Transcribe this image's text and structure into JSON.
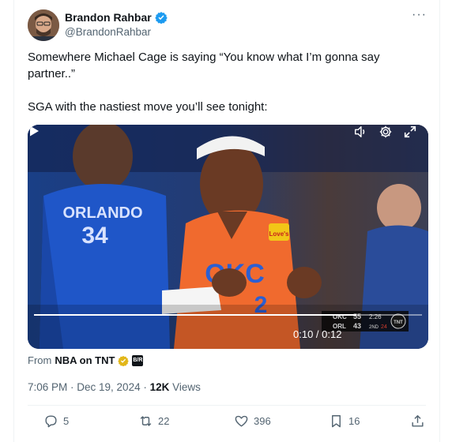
{
  "author": {
    "name": "Brandon Rahbar",
    "handle": "@BrandonRahbar",
    "verified": true
  },
  "more_menu": "···",
  "tweet": {
    "line1": "Somewhere Michael Cage is saying “You know what I’m gonna say partner..”",
    "line2": "SGA with the nastiest move you’ll see tonight:"
  },
  "video": {
    "time": "0:10 / 0:12",
    "progress": 0.83,
    "jersey_left": "ORLANDO",
    "jersey_left_number": "34",
    "jersey_right": "OKC",
    "jersey_right_number": "2",
    "patch": "Love's",
    "scorebug": {
      "team1": "OKC",
      "score1": "55",
      "team2": "ORL",
      "score2": "43",
      "clock": "2:26",
      "period": "2ND",
      "shot_clock": "24",
      "network": "TNT"
    }
  },
  "source": {
    "prefix": "From",
    "name": "NBA on TNT",
    "badge": "B/R"
  },
  "meta": {
    "time": "7:06 PM · Dec 19, 2024 · ",
    "views_count": "12K",
    "views_label": " Views"
  },
  "actions": {
    "replies": "5",
    "reposts": "22",
    "likes": "396",
    "bookmarks": "16"
  },
  "colors": {
    "verified": "#1d9bf0",
    "gold_badge": "#e2b719",
    "text": "#0f1419",
    "secondary": "#536471"
  }
}
